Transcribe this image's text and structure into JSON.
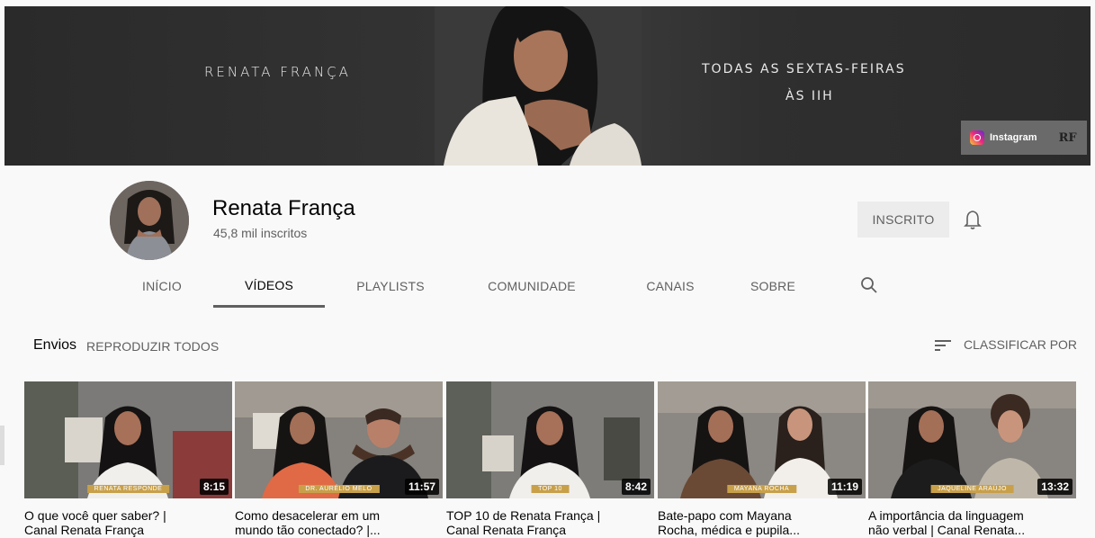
{
  "banner": {
    "name_text": "RENATA FRANÇA",
    "tagline_line1": "TODAS AS SEXTAS-FEIRAS",
    "tagline_line2": "ÀS IIH",
    "instagram_label": "Instagram",
    "site_logo_text": "RF"
  },
  "channel": {
    "name": "Renata França",
    "subscribers": "45,8 mil inscritos",
    "subscribe_label": "INSCRITO"
  },
  "tabs": [
    {
      "label": "INÍCIO"
    },
    {
      "label": "VÍDEOS"
    },
    {
      "label": "PLAYLISTS"
    },
    {
      "label": "COMUNIDADE"
    },
    {
      "label": "CANAIS"
    },
    {
      "label": "SOBRE"
    }
  ],
  "active_tab": "VÍDEOS",
  "section": {
    "title": "Envios",
    "play_all": "REPRODUZIR TODOS",
    "sort_label": "CLASSIFICAR POR"
  },
  "videos": [
    {
      "title_line1": "O que você quer saber? |",
      "title_line2": "Canal Renata França",
      "duration": "8:15",
      "ribbon": "RENATA RESPONDE"
    },
    {
      "title_line1": "Como desacelerar em um",
      "title_line2": "mundo tão conectado? |...",
      "duration": "11:57",
      "ribbon": "DR. AURÉLIO MELO"
    },
    {
      "title_line1": "TOP 10 de Renata França |",
      "title_line2": "Canal Renata França",
      "duration": "8:42",
      "ribbon": "TOP 10"
    },
    {
      "title_line1": "Bate-papo com Mayana",
      "title_line2": "Rocha, médica e pupila...",
      "duration": "11:19",
      "ribbon": "MAYANA ROCHA"
    },
    {
      "title_line1": "A importância da linguagem",
      "title_line2": "não verbal | Canal Renata...",
      "duration": "13:32",
      "ribbon": "JAQUELINE ARAÚJO"
    }
  ],
  "colors": {
    "banner_bg": "#2d2d2d",
    "ribbon_gold": "#c8a04a",
    "subscribed_bg": "#ececec"
  }
}
